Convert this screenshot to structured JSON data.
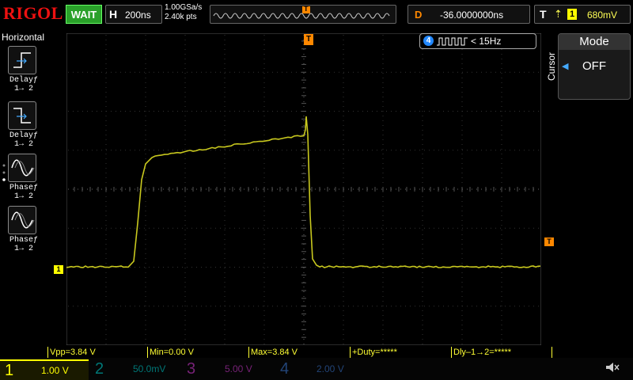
{
  "header": {
    "brand": "RIGOL",
    "run_state": "WAIT",
    "horizontal_label": "H",
    "timebase": "200ns",
    "sample_rate": "1.00GSa/s",
    "memory_depth": "2.40k pts",
    "delay_label": "D",
    "delay_value": "-36.0000000ns",
    "trigger_label": "T",
    "trigger_source": "1",
    "trigger_level": "680mV",
    "trigger_position_marker": "T"
  },
  "left_menu": {
    "title": "Horizontal",
    "items": [
      {
        "label": "Delay",
        "sub": "1→ 2",
        "icon": "delay-rise-icon"
      },
      {
        "label": "Delay",
        "sub": "1→ 2",
        "icon": "delay-fall-icon"
      },
      {
        "label": "Phase",
        "sub": "1→ 2",
        "icon": "phase-rise-icon"
      },
      {
        "label": "Phase",
        "sub": "1→ 2",
        "icon": "phase-fall-icon"
      }
    ]
  },
  "frequency_counter": {
    "channel": "4",
    "text": "< 15Hz"
  },
  "right_panel": {
    "side_label": "Cursor",
    "mode_title": "Mode",
    "mode_value": "OFF"
  },
  "waveform": {
    "channel_marker": "1",
    "trigger_level_marker": "T",
    "color": "#c8c81e"
  },
  "measurements": [
    {
      "text": "Vpp=3.84 V"
    },
    {
      "text": "Min=0.00 V"
    },
    {
      "text": "Max=3.84 V"
    },
    {
      "text": "+Duty=*****"
    },
    {
      "text": "Dly–1→2=*****"
    }
  ],
  "channels": [
    {
      "num": "1",
      "scale": "1.00 V",
      "color": "#ffff00",
      "active": true
    },
    {
      "num": "2",
      "scale": "50.0mV",
      "color": "#00c0c0",
      "active": false
    },
    {
      "num": "3",
      "scale": "5.00 V",
      "color": "#d040d0",
      "active": false
    },
    {
      "num": "4",
      "scale": "2.00 V",
      "color": "#2080ff",
      "active": false
    }
  ],
  "colors": {
    "brand": "#ee1111",
    "run": "#2aa12a",
    "delay": "#ff8800",
    "trace": "#c8c81e",
    "grid": "#2a2a2a"
  }
}
